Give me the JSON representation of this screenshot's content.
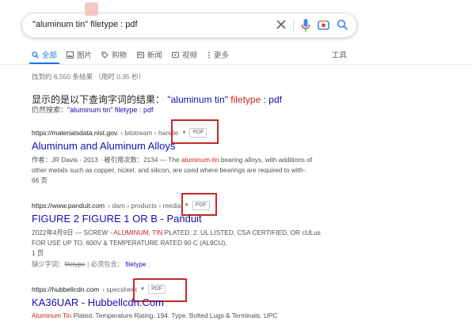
{
  "search": {
    "query": "\"aluminum tin\" filetype : pdf"
  },
  "tabs": [
    {
      "label": "全部",
      "icon": "search-icon",
      "active": true
    },
    {
      "label": "图片",
      "icon": "image-icon"
    },
    {
      "label": "购物",
      "icon": "shopping-icon"
    },
    {
      "label": "新闻",
      "icon": "news-icon"
    },
    {
      "label": "视频",
      "icon": "video-icon"
    },
    {
      "label": "更多",
      "icon": "more-vert-icon"
    }
  ],
  "tools_label": "工具",
  "stats": "找到约 6,550 条结果 （用时 0.35 秒）",
  "showing": {
    "prefix": "显示的是以下查询字词的结果：",
    "q1": "\"aluminum tin\"",
    "q2": "filetype",
    "q3": ": pdf"
  },
  "still": {
    "prefix": "仍然搜索：",
    "link": "\"aluminum tin\" filetype : pdf"
  },
  "results": [
    {
      "domain": "https://materialsdata.nist.gov",
      "path": "› bitstream › handle",
      "tag": "PDF",
      "title": "Aluminum and Aluminum Alloys",
      "meta": "作者：JR Davis · 2013 · 被引用次数：2134 — The ",
      "hl": "aluminum-tin",
      "rest": " bearing alloys, with additions of other metals such as copper, nickel, and silicon, are used where bearings are required to with-.",
      "pages": "66 页"
    },
    {
      "domain": "https://www.panduit.com",
      "path": "› dam › products › media",
      "tag": "PDF",
      "title": "FIGURE 2 FIGURE 1 OR B - Panduit",
      "meta": "2022年4月9日 — SCREW - ",
      "hl": "ALUMINUM, TIN",
      "rest": " PLATED. 2. UL LISTED, CSA CERTIFIED, OR cULus FOR USE UP TO. 600V & TEMPERATURE RATED 90 C (AL9CU).",
      "pages": "1 页",
      "missing_label": "缺少字词：",
      "missing_word": "filetype",
      "must_label": "| 必须包含：",
      "must_word": "filetype"
    },
    {
      "domain": "https://hubbellcdn.com",
      "path": "› specsheet",
      "tag": "PDF",
      "title": "KA36UAR - Hubbellcdn.Com",
      "hl": "Aluminum Tin",
      "rest": " Plated. Temperature Rating. 194. Type. Bolted Lugs & Terminals. UPC"
    }
  ],
  "colors": {
    "link": "#1a0dab",
    "accent": "#1a73e8",
    "highlight_red": "#c5221f",
    "annotation_box": "#c62828"
  }
}
